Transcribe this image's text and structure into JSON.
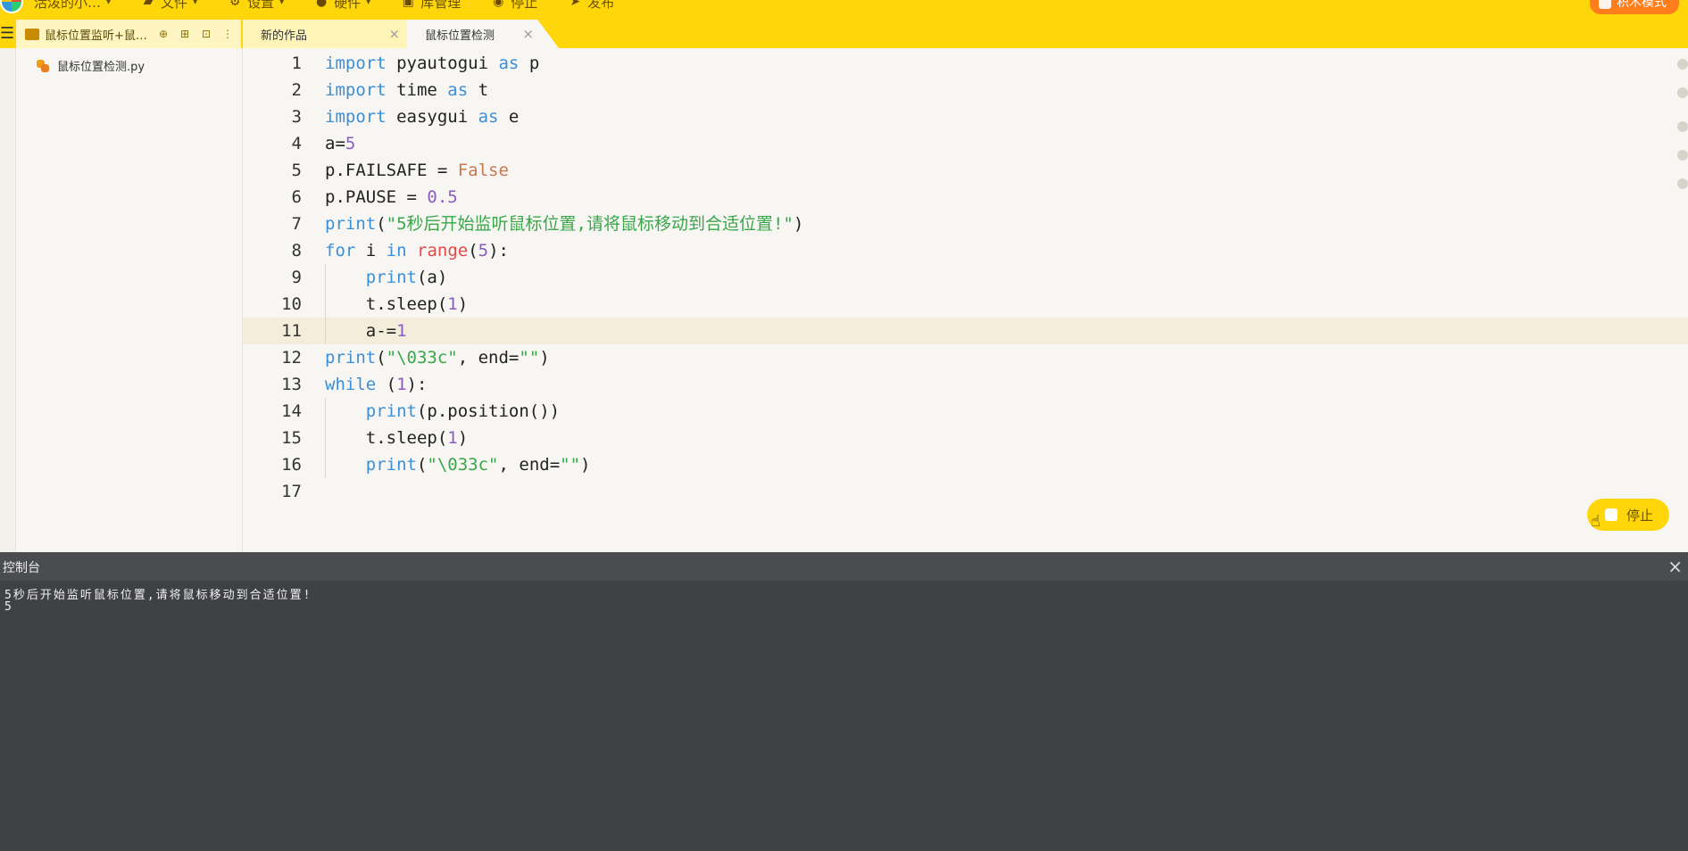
{
  "topbar": {
    "user_name": "活泼的小…",
    "menu": [
      {
        "label": "文件",
        "icon": "folder-icon"
      },
      {
        "label": "设置",
        "icon": "gear-icon"
      },
      {
        "label": "硬件",
        "icon": "hardware-icon"
      },
      {
        "label": "库管理",
        "icon": "library-icon"
      },
      {
        "label": "停止",
        "icon": "stop-icon"
      },
      {
        "label": "发布",
        "icon": "publish-icon"
      }
    ],
    "mode_button": "积木模式",
    "accent_color": "#ffd60a"
  },
  "tabs": {
    "project": "鼠标位置监听+鼠…",
    "items": [
      {
        "label": "新的作品",
        "close": "×"
      },
      {
        "label": "鼠标位置检测",
        "close": "×"
      }
    ]
  },
  "sidebar": {
    "files": [
      {
        "name": "鼠标位置检测.py",
        "icon": "python-file-icon"
      }
    ]
  },
  "editor": {
    "line_numbers": [
      "1",
      "2",
      "3",
      "4",
      "5",
      "6",
      "7",
      "8",
      "9",
      "10",
      "11",
      "12",
      "13",
      "14",
      "15",
      "16",
      "17"
    ],
    "active_line": 11,
    "lines": [
      "import pyautogui as p",
      "import time as t",
      "import easygui as e",
      "a=5",
      "p.FAILSAFE = False",
      "p.PAUSE = 0.5",
      "print(\"5秒后开始监听鼠标位置,请将鼠标移动到合适位置!\")",
      "for i in range(5):",
      "    print(a)",
      "    t.sleep(1)",
      "    a-=1",
      "print(\"\\033c\", end=\"\")",
      "while (1):",
      "    print(p.position())",
      "    t.sleep(1)",
      "    print(\"\\033c\", end=\"\")",
      ""
    ]
  },
  "stop_float": {
    "label": "停止"
  },
  "console": {
    "title": "控制台",
    "close": "×",
    "output": [
      "5秒后开始监听鼠标位置,请将鼠标移动到合适位置!",
      "5"
    ]
  }
}
